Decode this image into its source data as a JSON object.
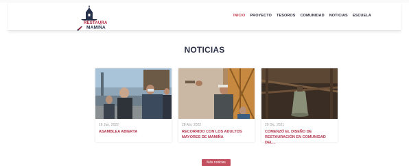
{
  "logo": {
    "line1": "RESTAURA",
    "line2": "MAMIÑA"
  },
  "nav": {
    "items": [
      {
        "label": "INICIO"
      },
      {
        "label": "PROYECTO"
      },
      {
        "label": "TESOROS"
      },
      {
        "label": "COMUNIDAD"
      },
      {
        "label": "NOTICIAS"
      },
      {
        "label": "ESCUELA"
      }
    ]
  },
  "section": {
    "title": "NOTICIAS"
  },
  "cards": [
    {
      "date": "16 Jun, 2022",
      "title": "ASAMBLEA ABIERTA"
    },
    {
      "date": "28 Abr, 2022",
      "title": "RECORRIDO CON LOS ADULTOS MAYORES DE MAMIÑA"
    },
    {
      "date": "20 Dic, 2021",
      "title": "COMENZÓ EL DISEÑO DE RESTAURACIÓN EN COMUNIDAD DEL..."
    }
  ],
  "more_button": {
    "label": "Más noticias"
  },
  "colors": {
    "accent": "#b3314a",
    "nav_active": "#c0394b",
    "title": "#2b3047",
    "button": "#c4505f"
  }
}
